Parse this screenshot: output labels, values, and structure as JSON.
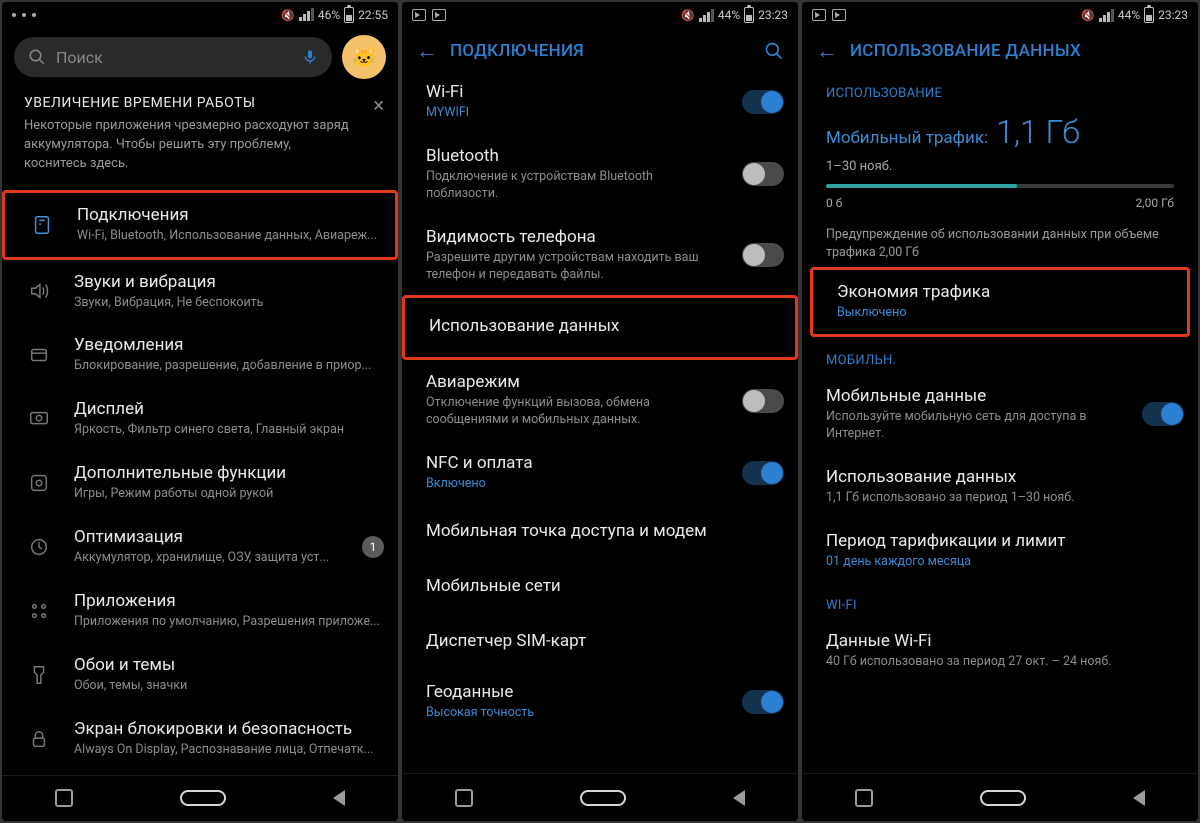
{
  "phone1": {
    "status": {
      "battery": "46%",
      "time": "22:55"
    },
    "search_placeholder": "Поиск",
    "banner": {
      "title": "УВЕЛИЧЕНИЕ ВРЕМЕНИ РАБОТЫ",
      "body": "Некоторые приложения чрезмерно расходуют заряд аккумулятора. Чтобы решить эту проблему, коснитесь здесь."
    },
    "items": [
      {
        "title": "Подключения",
        "sub": "Wi-Fi, Bluetooth, Использование данных, Авиареж..."
      },
      {
        "title": "Звуки и вибрация",
        "sub": "Звуки, Вибрация, Не беспокоить"
      },
      {
        "title": "Уведомления",
        "sub": "Блокирование, разрешение, добавление в приор..."
      },
      {
        "title": "Дисплей",
        "sub": "Яркость, Фильтр синего света, Главный экран"
      },
      {
        "title": "Дополнительные функции",
        "sub": "Игры, Режим работы одной рукой"
      },
      {
        "title": "Оптимизация",
        "sub": "Аккумулятор, хранилище, ОЗУ, защита уст...",
        "badge": "1"
      },
      {
        "title": "Приложения",
        "sub": "Приложения по умолчанию, Разрешения приложе..."
      },
      {
        "title": "Обои и темы",
        "sub": "Обои, темы, значки"
      },
      {
        "title": "Экран блокировки и безопасность",
        "sub": "Always On Display, Распознавание лица, Отпечатк..."
      }
    ]
  },
  "phone2": {
    "status": {
      "battery": "44%",
      "time": "23:23"
    },
    "title": "ПОДКЛЮЧЕНИЯ",
    "items": [
      {
        "title": "Wi-Fi",
        "sub": "MYWIFI",
        "sub_blue": true,
        "toggle": "on"
      },
      {
        "title": "Bluetooth",
        "sub": "Подключение к устройствам Bluetooth поблизости.",
        "toggle": "off"
      },
      {
        "title": "Видимость телефона",
        "sub": "Разрешите другим устройствам находить ваш телефон и передавать файлы.",
        "toggle": "off"
      },
      {
        "title": "Использование данных"
      },
      {
        "title": "Авиарежим",
        "sub": "Отключение функций вызова, обмена сообщениями и мобильных данных.",
        "toggle": "off"
      },
      {
        "title": "NFC и оплата",
        "sub": "Включено",
        "sub_blue": true,
        "toggle": "on"
      },
      {
        "title": "Мобильная точка доступа и модем"
      },
      {
        "title": "Мобильные сети"
      },
      {
        "title": "Диспетчер SIM-карт"
      },
      {
        "title": "Геоданные",
        "sub": "Высокая точность",
        "sub_blue": true,
        "toggle": "on"
      }
    ]
  },
  "phone3": {
    "status": {
      "battery": "44%",
      "time": "23:23"
    },
    "title": "ИСПОЛЬЗОВАНИЕ ДАННЫХ",
    "section_usage": "ИСПОЛЬЗОВАНИЕ",
    "usage": {
      "label": "Мобильный трафик:",
      "value": "1,1 Гб",
      "period": "1–30 нояб.",
      "bar_min": "0 б",
      "bar_max": "2,00 Гб",
      "warning": "Предупреждение об использовании данных при объеме трафика 2,00 Гб"
    },
    "saver": {
      "title": "Экономия трафика",
      "sub": "Выключено"
    },
    "section_mobile": "МОБИЛЬН.",
    "mobile_items": [
      {
        "title": "Мобильные данные",
        "sub": "Используйте мобильную сеть для доступа в Интернет.",
        "toggle": "on"
      },
      {
        "title": "Использование данных",
        "sub": "1,1 Гб использовано за период 1–30 нояб."
      },
      {
        "title": "Период тарификации и лимит",
        "sub": "01 день каждого месяца",
        "sub_blue": true
      }
    ],
    "section_wifi": "WI-FI",
    "wifi_items": [
      {
        "title": "Данные Wi-Fi",
        "sub": "40 Гб использовано за период 27 окт. – 24 нояб."
      }
    ]
  }
}
